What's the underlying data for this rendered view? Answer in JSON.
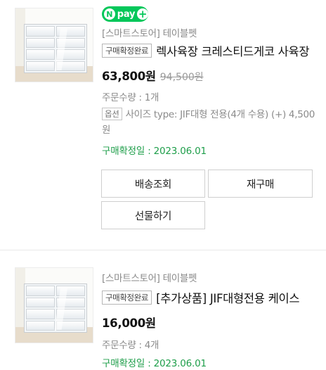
{
  "orders": [
    {
      "store": "[스마트스토어] 테이블펫",
      "status_badge": "구매확정완료",
      "title": "렉사육장 크레스티드게코 사육장",
      "price": "63,800원",
      "original_price": "94,500원",
      "quantity": "주문수량 : 1개",
      "option_label": "옵션",
      "option_text": "사이즈 type: JIF대형 전용(4개 수용) (+) 4,500원",
      "confirmed_date": "구매확정일 : 2023.06.01",
      "buttons": {
        "track": "배송조회",
        "rebuy": "재구매",
        "gift": "선물하기"
      },
      "has_npay": true
    },
    {
      "store": "[스마트스토어] 테이블펫",
      "status_badge": "구매확정완료",
      "title": "[추가상품] JIF대형전용 케이스",
      "price": "16,000원",
      "quantity": "주문수량 : 4개",
      "confirmed_date": "구매확정일 : 2023.06.01"
    }
  ],
  "npay": {
    "n": "N",
    "text": "pay",
    "plus": "+"
  },
  "colors": {
    "npay_green": "#03c75a",
    "confirm_green": "#1e9e4a",
    "muted": "#8a8a8a"
  }
}
